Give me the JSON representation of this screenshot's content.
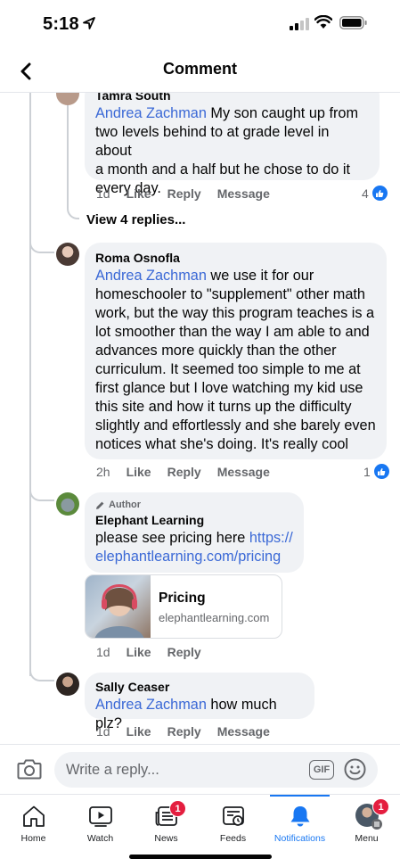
{
  "status_bar": {
    "time": "5:18"
  },
  "header": {
    "title": "Comment"
  },
  "comments": [
    {
      "author": "Tamra South",
      "mention": "Andrea Zachman",
      "lines": [
        " My son caught up from",
        "two levels behind to at grade level in about",
        "a month and a half but he chose to do it",
        "every day."
      ],
      "time": "1d",
      "like": "Like",
      "reply": "Reply",
      "message": "Message",
      "reactions": "4"
    },
    {
      "author": "Roma Osnofla",
      "mention": "Andrea Zachman",
      "lines": [
        " we use it for our",
        "homeschooler to \"supplement\" other math",
        "work, but the way this program teaches is a",
        "lot smoother than the way I am able to and",
        "advances more quickly than the other",
        "curriculum. It seemed too simple to me at",
        "first glance but I love watching my kid use",
        "this site and how it turns up the difficulty",
        "slightly and effortlessly and she barely even",
        "notices what she's doing. It's really cool"
      ],
      "time": "2h",
      "like": "Like",
      "reply": "Reply",
      "message": "Message",
      "reactions": "1"
    },
    {
      "badge": "Author",
      "author": "Elephant Learning",
      "text": "please see pricing here ",
      "link_part1": "https://",
      "link_part2": "elephantlearning.com/pricing",
      "card": {
        "title": "Pricing",
        "domain": "elephantlearning.com"
      },
      "time": "1d",
      "like": "Like",
      "reply": "Reply"
    },
    {
      "author": "Sally Ceaser",
      "mention": "Andrea Zachman",
      "text": " how much plz?",
      "time": "1d",
      "like": "Like",
      "reply": "Reply",
      "message": "Message"
    }
  ],
  "view_replies": "View 4 replies...",
  "composer": {
    "placeholder": "Write a reply...",
    "gif_label": "GIF"
  },
  "tabs": [
    {
      "label": "Home"
    },
    {
      "label": "Watch"
    },
    {
      "label": "News",
      "badge": "1"
    },
    {
      "label": "Feeds"
    },
    {
      "label": "Notifications",
      "active": true
    },
    {
      "label": "Menu",
      "badge": "1"
    }
  ],
  "colors": {
    "accent": "#1877f2",
    "mention": "#3b69d6",
    "badge": "#e41e3f",
    "bubble": "#f0f2f5"
  }
}
